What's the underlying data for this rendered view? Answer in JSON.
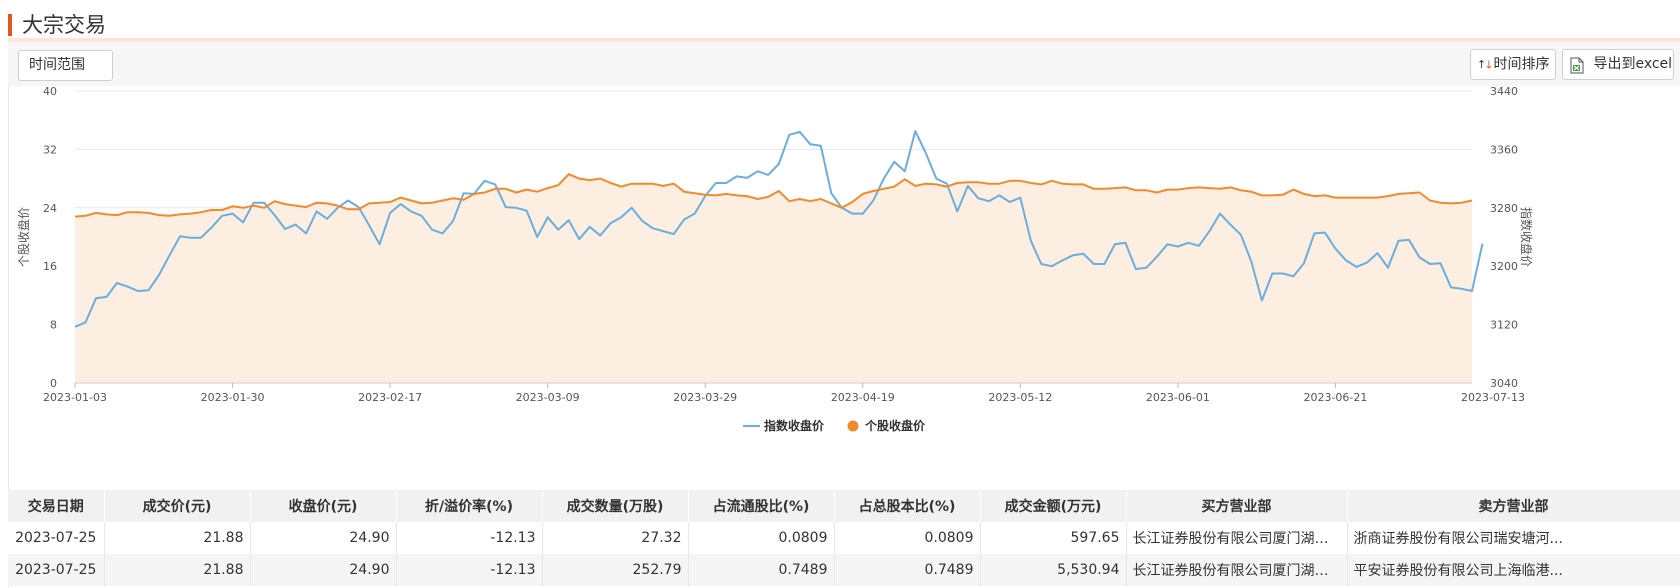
{
  "page": {
    "title": "大宗交易"
  },
  "toolbar": {
    "range_label": "时间范围",
    "sort_label": "时间排序",
    "export_label": "导出到excel"
  },
  "colors": {
    "index": "#6aaedd",
    "stock": "#f08a2c",
    "accent": "#e2581f",
    "area": "#fdeee2"
  },
  "chart_data": {
    "type": "line",
    "x_ticks": [
      "2023-01-03",
      "2023-01-30",
      "2023-02-17",
      "2023-03-09",
      "2023-03-29",
      "2023-04-19",
      "2023-05-12",
      "2023-06-01",
      "2023-06-21",
      "2023-07-13"
    ],
    "y_left": {
      "label": "个股收盘价",
      "min": 0,
      "max": 40,
      "ticks": [
        "0",
        "8",
        "16",
        "24",
        "32",
        "40"
      ]
    },
    "y_right": {
      "label": "指数收盘价",
      "min": 3040,
      "max": 3440,
      "ticks": [
        "3040",
        "3120",
        "3200",
        "3280",
        "3360",
        "3440"
      ]
    },
    "legend": [
      "指数收盘价",
      "个股收盘价"
    ],
    "legend_position": "bottom-center",
    "series": [
      {
        "name": "指数收盘价",
        "axis": "right",
        "values": [
          3117,
          3123,
          3156,
          3158,
          3177,
          3172,
          3166,
          3167,
          3188,
          3215,
          3241,
          3239,
          3239,
          3253,
          3269,
          3272,
          3260,
          3287,
          3287,
          3270,
          3251,
          3257,
          3245,
          3275,
          3265,
          3280,
          3290,
          3281,
          3256,
          3230,
          3273,
          3285,
          3275,
          3269,
          3250,
          3245,
          3262,
          3300,
          3299,
          3317,
          3312,
          3281,
          3280,
          3276,
          3240,
          3267,
          3250,
          3263,
          3237,
          3254,
          3242,
          3259,
          3267,
          3280,
          3262,
          3252,
          3248,
          3244,
          3264,
          3272,
          3296,
          3314,
          3314,
          3323,
          3321,
          3330,
          3325,
          3340,
          3380,
          3384,
          3367,
          3365,
          3300,
          3280,
          3272,
          3272,
          3290,
          3320,
          3343,
          3330,
          3385,
          3355,
          3320,
          3313,
          3275,
          3310,
          3293,
          3289,
          3297,
          3288,
          3294,
          3235,
          3203,
          3200,
          3208,
          3215,
          3217,
          3203,
          3203,
          3230,
          3232,
          3196,
          3198,
          3213,
          3230,
          3227,
          3232,
          3228,
          3248,
          3272,
          3257,
          3243,
          3206,
          3153,
          3190,
          3190,
          3186,
          3204,
          3245,
          3246,
          3224,
          3208,
          3199,
          3205,
          3218,
          3198,
          3235,
          3236,
          3212,
          3203,
          3204,
          3171,
          3169,
          3166,
          3231
        ]
      },
      {
        "name": "个股收盘价",
        "axis": "left",
        "values": [
          22.8,
          22.9,
          23.3,
          23.1,
          23.0,
          23.4,
          23.4,
          23.3,
          23.0,
          22.9,
          23.1,
          23.2,
          23.4,
          23.7,
          23.7,
          24.2,
          24.0,
          24.3,
          24.0,
          24.9,
          24.5,
          24.3,
          24.1,
          24.7,
          24.6,
          24.3,
          23.8,
          23.8,
          24.6,
          24.7,
          24.8,
          25.4,
          25.0,
          24.6,
          24.7,
          25.0,
          25.3,
          25.1,
          25.9,
          26.1,
          26.6,
          26.6,
          26.1,
          26.5,
          26.2,
          26.7,
          27.1,
          28.6,
          28.0,
          27.8,
          28.0,
          27.4,
          26.9,
          27.3,
          27.3,
          27.3,
          27.0,
          27.3,
          26.2,
          26.0,
          25.8,
          25.7,
          25.9,
          25.7,
          25.6,
          25.2,
          25.5,
          26.3,
          24.9,
          25.2,
          24.9,
          25.2,
          24.6,
          24.0,
          24.8,
          25.9,
          26.3,
          26.6,
          26.9,
          27.9,
          27.0,
          27.3,
          27.2,
          26.9,
          27.4,
          27.5,
          27.5,
          27.3,
          27.3,
          27.7,
          27.7,
          27.4,
          27.2,
          27.7,
          27.3,
          27.2,
          27.2,
          26.6,
          26.6,
          26.7,
          26.8,
          26.4,
          26.4,
          26.1,
          26.5,
          26.5,
          26.7,
          26.8,
          26.7,
          26.6,
          26.8,
          26.4,
          26.2,
          25.7,
          25.7,
          25.8,
          26.5,
          25.9,
          25.6,
          25.7,
          25.4,
          25.4,
          25.4,
          25.4,
          25.4,
          25.6,
          25.9,
          26.0,
          26.1,
          25.0,
          24.7,
          24.6,
          24.7,
          25.0
        ]
      }
    ]
  },
  "table": {
    "headers": [
      "交易日期",
      "成交价(元)",
      "收盘价(元)",
      "折/溢价率(%)",
      "成交数量(万股)",
      "占流通股比(%)",
      "占总股本比(%)",
      "成交金额(万元)",
      "买方营业部",
      "卖方营业部"
    ],
    "rows": [
      [
        "2023-07-25",
        "21.88",
        "24.90",
        "-12.13",
        "27.32",
        "0.0809",
        "0.0809",
        "597.65",
        "长江证券股份有限公司厦门湖滨北...",
        "浙商证券股份有限公司瑞安塘河..."
      ],
      [
        "2023-07-25",
        "21.88",
        "24.90",
        "-12.13",
        "252.79",
        "0.7489",
        "0.7489",
        "5,530.94",
        "长江证券股份有限公司厦门湖滨北...",
        "平安证券股份有限公司上海临港..."
      ]
    ]
  }
}
